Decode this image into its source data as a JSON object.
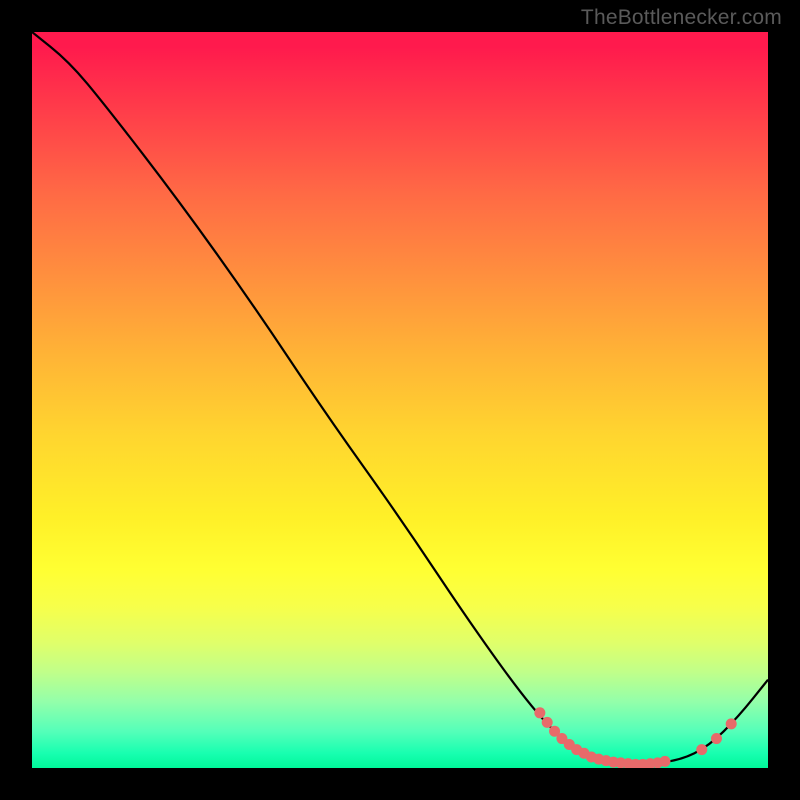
{
  "attribution": "TheBottlenecker.com",
  "chart_data": {
    "type": "line",
    "title": "",
    "xlabel": "",
    "ylabel": "",
    "xlim": [
      0,
      100
    ],
    "ylim": [
      0,
      100
    ],
    "series": [
      {
        "name": "curve",
        "points": [
          {
            "x": 0,
            "y": 100
          },
          {
            "x": 5,
            "y": 96
          },
          {
            "x": 10,
            "y": 90
          },
          {
            "x": 20,
            "y": 77
          },
          {
            "x": 30,
            "y": 63
          },
          {
            "x": 40,
            "y": 48
          },
          {
            "x": 50,
            "y": 34
          },
          {
            "x": 60,
            "y": 19
          },
          {
            "x": 68,
            "y": 8
          },
          {
            "x": 73,
            "y": 3
          },
          {
            "x": 78,
            "y": 1
          },
          {
            "x": 83,
            "y": 0.5
          },
          {
            "x": 88,
            "y": 1
          },
          {
            "x": 92,
            "y": 3
          },
          {
            "x": 96,
            "y": 7
          },
          {
            "x": 100,
            "y": 12
          }
        ]
      }
    ],
    "markers": [
      {
        "x": 69,
        "y": 7.5
      },
      {
        "x": 70,
        "y": 6.2
      },
      {
        "x": 71,
        "y": 5.0
      },
      {
        "x": 72,
        "y": 4.0
      },
      {
        "x": 73,
        "y": 3.2
      },
      {
        "x": 74,
        "y": 2.5
      },
      {
        "x": 75,
        "y": 2.0
      },
      {
        "x": 76,
        "y": 1.5
      },
      {
        "x": 77,
        "y": 1.2
      },
      {
        "x": 78,
        "y": 1.0
      },
      {
        "x": 79,
        "y": 0.8
      },
      {
        "x": 80,
        "y": 0.7
      },
      {
        "x": 81,
        "y": 0.6
      },
      {
        "x": 82,
        "y": 0.5
      },
      {
        "x": 83,
        "y": 0.5
      },
      {
        "x": 84,
        "y": 0.6
      },
      {
        "x": 85,
        "y": 0.7
      },
      {
        "x": 86,
        "y": 0.9
      },
      {
        "x": 91,
        "y": 2.5
      },
      {
        "x": 93,
        "y": 4.0
      },
      {
        "x": 95,
        "y": 6.0
      }
    ],
    "marker_color": "#e86a6a",
    "line_color": "#000000"
  }
}
